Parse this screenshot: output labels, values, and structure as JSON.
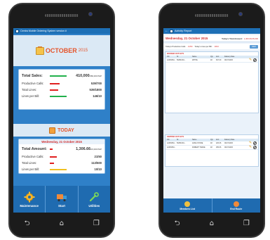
{
  "left": {
    "title": "Centra Mobile Ordering System version #",
    "month": {
      "name": "OCTOBER",
      "year": "2015"
    },
    "stats": {
      "total_sales": {
        "label": "Total Sales:",
        "value": "410,000",
        "target": "/280,000 PHP",
        "bar_color": "#22b14c"
      },
      "productive_calls": {
        "label": "Productive Calls:",
        "value": "539/700",
        "bar_color": "#e02020"
      },
      "total_lines": {
        "label": "Total Lines:",
        "value": "539/1800",
        "bar_color": "#e02020"
      },
      "lines_per_bill": {
        "label": "Lines per Bill:",
        "value": "146/10",
        "bar_color": "#22b14c"
      }
    },
    "today": {
      "label": "TODAY",
      "date": "Wednesday, 21 October 2015",
      "total_amount": {
        "label": "Total Amount:",
        "value": "1,306.66",
        "target": "/15,000 PHP",
        "bar_color": "#e02020"
      },
      "productive_calls": {
        "label": "Productive Calls:",
        "value": "21/50",
        "bar_color": "#e02020"
      },
      "total_lines": {
        "label": "Total Lines:",
        "value": "113/500",
        "bar_color": "#e02020"
      },
      "lines_per_bill": {
        "label": "Lines per Bill:",
        "value": "10/10",
        "bar_color": "#f0c020"
      }
    },
    "tiles": [
      {
        "label": "Maintenance",
        "icon": "gear-icon"
      },
      {
        "label": "Start",
        "icon": "truck-icon"
      },
      {
        "label": "Utilities",
        "icon": "wrench-icon"
      }
    ]
  },
  "right": {
    "title": "Activity Report",
    "date": "Wednesday, 21 October 2015",
    "total_label": "Today's Total Amount:",
    "total_value": "1,306.66/15,000",
    "sub": {
      "calls_label": "Today's Productive Calls:",
      "calls_value": "21/50",
      "lines_label": "Today's Lines per Bill:",
      "lines_value": "10/10",
      "button": "SKIP"
    },
    "table1": {
      "title": "BOOKED OUTLETS",
      "headers": [
        "OC",
        "SI",
        "Name",
        "Qty",
        "Amt",
        "Delivery Date"
      ],
      "rows": [
        [
          "12345364...",
          "5645F181...",
          "WHITE",
          "48",
          "847.30",
          "09/17/2015"
        ]
      ]
    },
    "table2": {
      "title": "SKIPPED OUTLETS",
      "headers": [
        "OC",
        "SI",
        "Name",
        "Qty",
        "Amt",
        "Delivery Date"
      ],
      "rows": [
        [
          "12345364...",
          "5645F181...",
          "ANNA STORE",
          "48",
          "425.36",
          "09/17/2015"
        ],
        [
          "12345364...",
          "",
          "ROBERT TRADE",
          "48",
          "256.66",
          "09/17/2015"
        ]
      ]
    },
    "buttons": [
      {
        "label": "Members List",
        "color": "#f0c040"
      },
      {
        "label": "End Route",
        "color": "#f08a3a"
      }
    ]
  },
  "nav": {
    "back": "⮌",
    "home": "⌂",
    "recent": "❐"
  }
}
